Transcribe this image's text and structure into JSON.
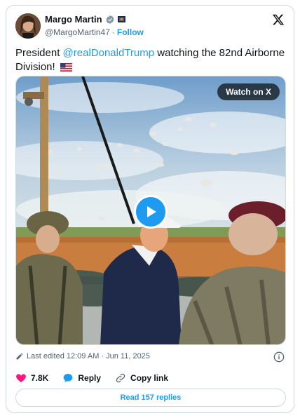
{
  "author": {
    "display_name": "Margo Martin",
    "handle": "@MargoMartin47",
    "separator": "·",
    "follow_label": "Follow"
  },
  "tweet": {
    "text_prefix": "President ",
    "mention": "@realDonaldTrump",
    "text_suffix": " watching the 82nd Airborne Division!"
  },
  "media": {
    "watch_label": "Watch on X"
  },
  "meta": {
    "edited": "Last edited 12:09 AM · Jun 11, 2025"
  },
  "actions": {
    "likes": "7.8K",
    "reply_label": "Reply",
    "copy_link_label": "Copy link"
  },
  "read_replies_label": "Read 157 replies",
  "colors": {
    "accent": "#1d9bf0",
    "like": "#f91880",
    "text": "#0f1419",
    "muted": "#536471",
    "border": "#cfd9de"
  },
  "icons": [
    "verified-badge-icon",
    "flag-icon",
    "x-logo-icon",
    "us-flag-icon",
    "play-icon",
    "pencil-icon",
    "info-icon",
    "heart-icon",
    "reply-bubble-icon",
    "link-icon"
  ]
}
